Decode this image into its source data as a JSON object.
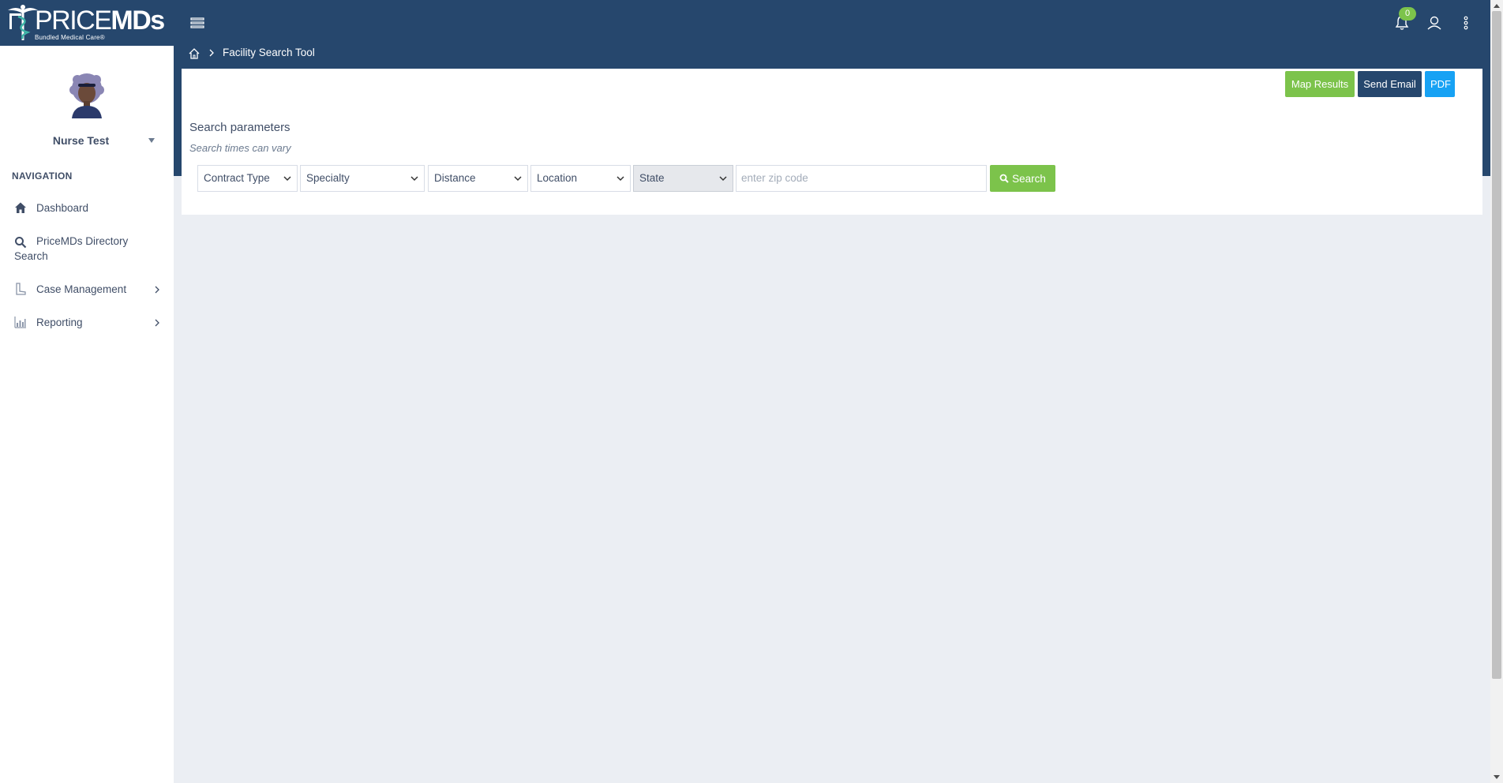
{
  "app": {
    "logo_text_light": "PRICE",
    "logo_text_bold": "MDs",
    "logo_tagline": "Bundled Medical Care®",
    "notification_count": "0",
    "brand_color": "#26476d",
    "accent_green": "#7cc34b",
    "accent_blue": "#17a2f4"
  },
  "header": {
    "icons": [
      "menu-icon",
      "bell-icon",
      "user-icon",
      "more-vertical-icon"
    ]
  },
  "sidebar": {
    "user_name": "Nurse Test",
    "nav_heading": "NAVIGATION",
    "items": [
      {
        "label": "Dashboard",
        "icon": "home-icon"
      },
      {
        "label": "PriceMDs Directory",
        "label2": "Search",
        "icon": "search-icon"
      },
      {
        "label": "Case Management",
        "icon": "boot-icon"
      },
      {
        "label": "Reporting",
        "icon": "chart-icon"
      }
    ]
  },
  "breadcrumb": {
    "current": "Facility Search Tool"
  },
  "actions": {
    "map_results": "Map Results",
    "send_email": "Send Email",
    "pdf": "PDF"
  },
  "search": {
    "title": "Search parameters",
    "subtitle": "Search times can vary",
    "filters": {
      "contract_type": "Contract Type",
      "specialty": "Specialty",
      "distance": "Distance",
      "location": "Location",
      "state": "State"
    },
    "zip_placeholder": "enter zip code",
    "button_label": "Search"
  }
}
